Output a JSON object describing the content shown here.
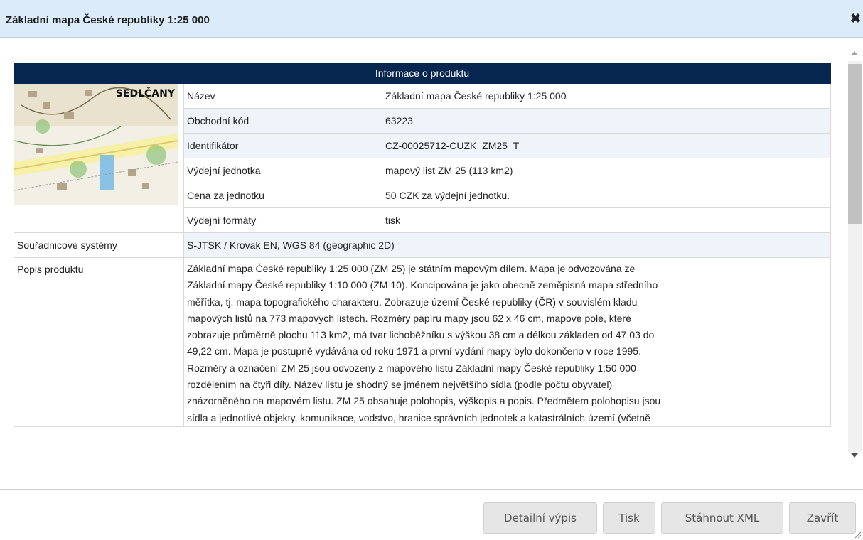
{
  "dialog": {
    "title": "Základní mapa České republiky 1:25 000",
    "close_icon": "close-icon"
  },
  "table": {
    "header": "Informace o produktu",
    "thumbnail": {
      "place_name": "SEDLČANY",
      "icon": "map-thumbnail-image"
    },
    "rows": [
      {
        "key": "Název",
        "value": "Základní mapa České republiky 1:25 000"
      },
      {
        "key": "Obchodní kód",
        "value": "63223"
      },
      {
        "key": "Identifikátor",
        "value": "CZ-00025712-CUZK_ZM25_T"
      },
      {
        "key": "Výdejní jednotka",
        "value": "mapový list ZM 25 (113 km2)"
      },
      {
        "key": "Cena za jednotku",
        "value": "50 CZK za výdejní jednotku."
      },
      {
        "key": "Výdejní formáty",
        "value": "tisk"
      }
    ],
    "coord_systems": {
      "key": "Souřadnicové systémy",
      "value": "S-JTSK / Krovak EN, WGS 84 (geographic 2D)"
    },
    "description": {
      "key": "Popis produktu",
      "lines": [
        "Základní mapa České republiky 1:25 000 (ZM 25) je státním mapovým dílem. Mapa je odvozována ze",
        "Základní mapy České republiky 1:10 000 (ZM 10). Koncipována je jako obecně zeměpisná mapa středního",
        "měřítka, tj. mapa topografického charakteru. Zobrazuje území České republiky (ČR) v souvislém kladu",
        "mapových listů na 773 mapových listech. Rozměry papíru mapy jsou 62 x 46 cm, mapové pole, které",
        "zobrazuje průměrně plochu 113 km2, má tvar lichoběžníku s výškou 38 cm a délkou základen od 47,03 do",
        "49,22 cm. Mapa je postupně vydávána od roku 1971 a první vydání mapy bylo dokončeno v roce 1995.",
        "Rozměry a označení ZM 25 jsou odvozeny z mapového listu Základní mapy České republiky 1:50 000",
        "rozdělením na čtyři díly. Název listu je shodný se jménem největšího sídla (podle počtu obyvatel)",
        "znázorněného na mapovém listu. ZM 25 obsahuje polohopis, výškopis a popis. Předmětem polohopisu jsou",
        "sídla a jednotlivé objekty, komunikace, vodstvo, hranice správních jednotek a katastrálních území (včetně"
      ]
    }
  },
  "buttons": {
    "detail": "Detailní výpis",
    "print": "Tisk",
    "download_xml": "Stáhnout XML",
    "close": "Zavřít"
  }
}
